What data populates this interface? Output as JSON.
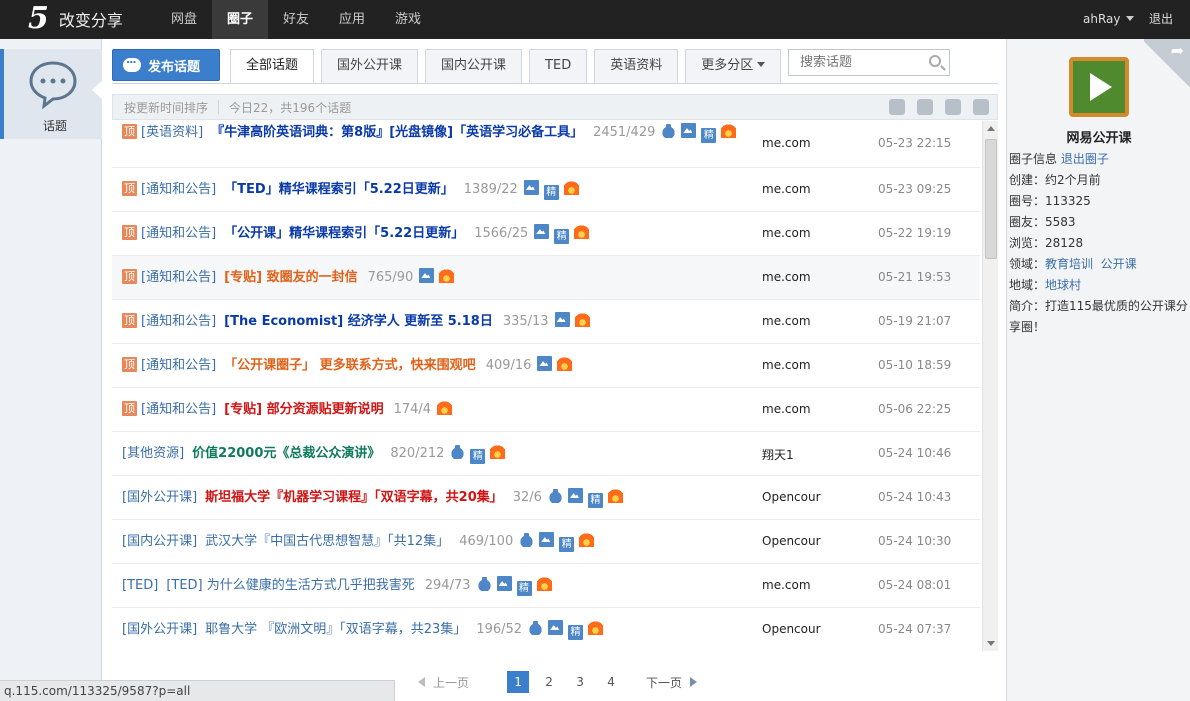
{
  "app": {
    "logo_mark": "5",
    "name": "改变分享"
  },
  "nav": [
    "网盘",
    "圈子",
    "好友",
    "应用",
    "游戏"
  ],
  "user": {
    "name": "ahRay",
    "logout": "退出"
  },
  "left": {
    "label": "话题"
  },
  "toolbar": {
    "post_button": "发布话题",
    "tabs": [
      "全部话题",
      "国外公开课",
      "国内公开课",
      "TED",
      "英语资料",
      "更多分区"
    ],
    "search_placeholder": "搜索话题"
  },
  "sortbar": {
    "sort_label": "按更新时间排序",
    "stats": "今日22，共196个话题"
  },
  "topics": [
    {
      "pin": "顶",
      "category": "[英语资料]",
      "title": "『牛津高阶英语词典：第8版』[光盘镜像]「英语学习必备工具」",
      "counts": "2451/429",
      "icons": [
        "bag",
        "pic",
        "jing",
        "fire"
      ],
      "author": "me.com",
      "date": "05-23 22:15",
      "style": "t-blue",
      "wrap": true
    },
    {
      "pin": "顶",
      "category": "[通知和公告]",
      "title": "「TED」精华课程索引「5.22日更新」",
      "counts": "1389/22",
      "icons": [
        "pic",
        "jing",
        "fire"
      ],
      "author": "me.com",
      "date": "05-23 09:25",
      "style": "t-blue"
    },
    {
      "pin": "顶",
      "category": "[通知和公告]",
      "title": "「公开课」精华课程索引「5.22日更新」",
      "counts": "1566/25",
      "icons": [
        "pic",
        "jing",
        "fire"
      ],
      "author": "me.com",
      "date": "05-22 19:19",
      "style": "t-blue"
    },
    {
      "pin": "顶",
      "category": "[通知和公告]",
      "title": "[专贴] 致圈友的一封信",
      "counts": "765/90",
      "icons": [
        "pic",
        "fire"
      ],
      "author": "me.com",
      "date": "05-21 19:53",
      "style": "t-orange",
      "highlight": true
    },
    {
      "pin": "顶",
      "category": "[通知和公告]",
      "title": "[The Economist] 经济学人 更新至 5.18日",
      "counts": "335/13",
      "icons": [
        "pic",
        "fire"
      ],
      "author": "me.com",
      "date": "05-19 21:07",
      "style": "t-blue"
    },
    {
      "pin": "顶",
      "category": "[通知和公告]",
      "title": "「公开课圈子」 更多联系方式，快来围观吧",
      "counts": "409/16",
      "icons": [
        "pic",
        "fire"
      ],
      "author": "me.com",
      "date": "05-10 18:59",
      "style": "t-orange"
    },
    {
      "pin": "顶",
      "category": "[通知和公告]",
      "title": "[专贴] 部分资源贴更新说明",
      "counts": "174/4",
      "icons": [
        "fire"
      ],
      "author": "me.com",
      "date": "05-06 22:25",
      "style": "t-red"
    },
    {
      "pin": "",
      "category": "[其他资源]",
      "title": "价值22000元《总裁公众演讲》",
      "counts": "820/212",
      "icons": [
        "bag",
        "jing",
        "fire"
      ],
      "author": "翔天1",
      "date": "05-24 10:46",
      "style": "t-green"
    },
    {
      "pin": "",
      "category": "[国外公开课]",
      "title": "斯坦福大学『机器学习课程』「双语字幕，共20集」",
      "counts": "32/6",
      "icons": [
        "bag",
        "pic",
        "jing",
        "fire"
      ],
      "author": "Opencour",
      "date": "05-24 10:43",
      "style": "t-red"
    },
    {
      "pin": "",
      "category": "[国内公开课]",
      "title": "武汉大学『中国古代思想智慧』「共12集」",
      "counts": "469/100",
      "icons": [
        "bag",
        "pic",
        "jing",
        "fire"
      ],
      "author": "Opencour",
      "date": "05-24 10:30",
      "style": "t-plain"
    },
    {
      "pin": "",
      "category": "[TED]",
      "title": "[TED] 为什么健康的生活方式几乎把我害死",
      "counts": "294/73",
      "icons": [
        "bag",
        "pic",
        "jing",
        "fire"
      ],
      "author": "me.com",
      "date": "05-24 08:01",
      "style": "t-plain"
    },
    {
      "pin": "",
      "category": "[国外公开课]",
      "title": "耶鲁大学 『欧洲文明』「双语字幕，共23集」",
      "counts": "196/52",
      "icons": [
        "bag",
        "pic",
        "jing",
        "fire"
      ],
      "author": "Opencour",
      "date": "05-24 07:37",
      "style": "t-plain"
    }
  ],
  "pager": {
    "prev": "上一页",
    "pages": [
      "1",
      "2",
      "3",
      "4"
    ],
    "current": "1",
    "next": "下一页"
  },
  "status_url": "q.115.com/113325/9587?p=all",
  "group": {
    "name": "网易公开课",
    "info_label": "圈子信息",
    "quit": "退出圈子",
    "created": "创建：约2个月前",
    "number": "圈号：113325",
    "members": "圈友：5583",
    "views": "浏览：28128",
    "field_label": "领域：",
    "fields": [
      "教育培训",
      "公开课"
    ],
    "region_label": "地域：",
    "region": "地球村",
    "intro": "简介：打造115最优质的公开课分享圈！"
  }
}
